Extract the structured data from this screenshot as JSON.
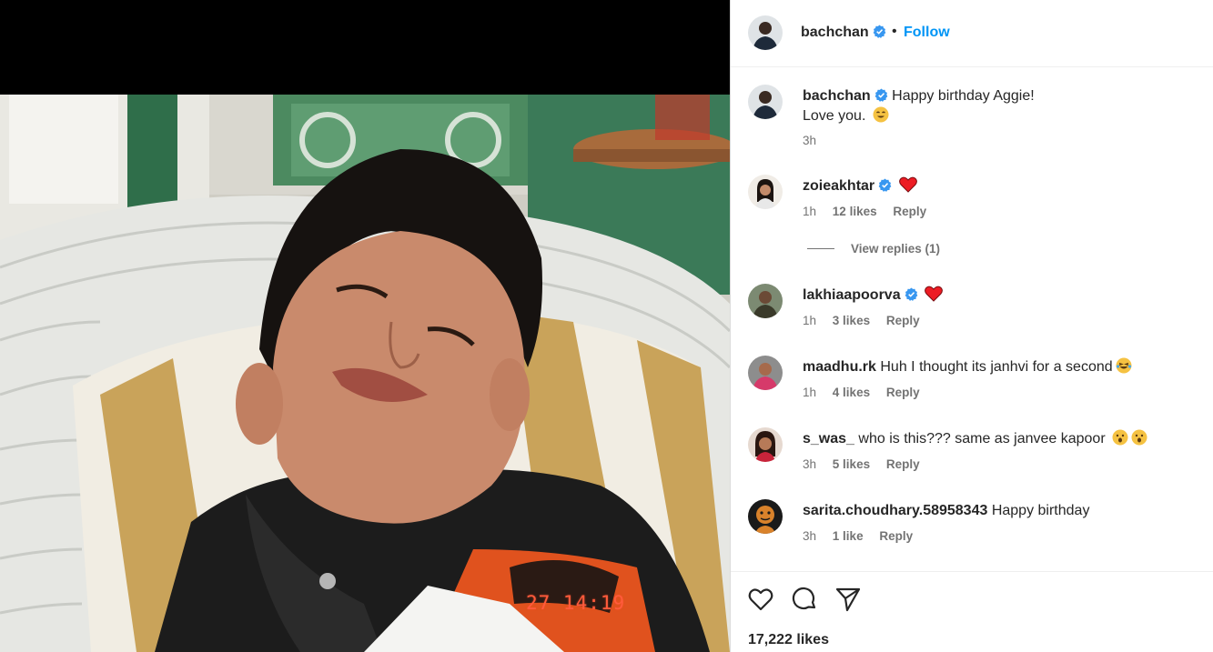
{
  "post": {
    "author": "bachchan",
    "follow_label": "Follow",
    "dot": "•",
    "photo_timestamp": "27 14:19"
  },
  "comments": [
    {
      "username": "bachchan",
      "text": "Happy birthday Aggie!",
      "text2": "Love you.",
      "time": "3h"
    },
    {
      "username": "zoieakhtar",
      "time": "1h",
      "likes": "12 likes",
      "reply": "Reply",
      "view_replies": "View replies (1)"
    },
    {
      "username": "lakhiaapoorva",
      "time": "1h",
      "likes": "3 likes",
      "reply": "Reply"
    },
    {
      "username": "maadhu.rk",
      "text": "Huh I thought its janhvi for a second",
      "time": "1h",
      "likes": "4 likes",
      "reply": "Reply"
    },
    {
      "username": "s_was_",
      "text": "who is this??? same as janvee kapoor",
      "time": "3h",
      "likes": "5 likes",
      "reply": "Reply"
    },
    {
      "username": "sarita.choudhary.58958343",
      "text": "Happy birthday",
      "time": "3h",
      "likes": "1 like",
      "reply": "Reply"
    }
  ],
  "actions": {
    "like_icon": "heart-outline-icon",
    "comment_icon": "comment-bubble-icon",
    "share_icon": "paper-plane-icon",
    "likes_count": "17,222 likes"
  },
  "colors": {
    "accent": "#0095f6",
    "verified": "#3897f0",
    "heart": "#ed1c24",
    "muted": "#737373"
  }
}
